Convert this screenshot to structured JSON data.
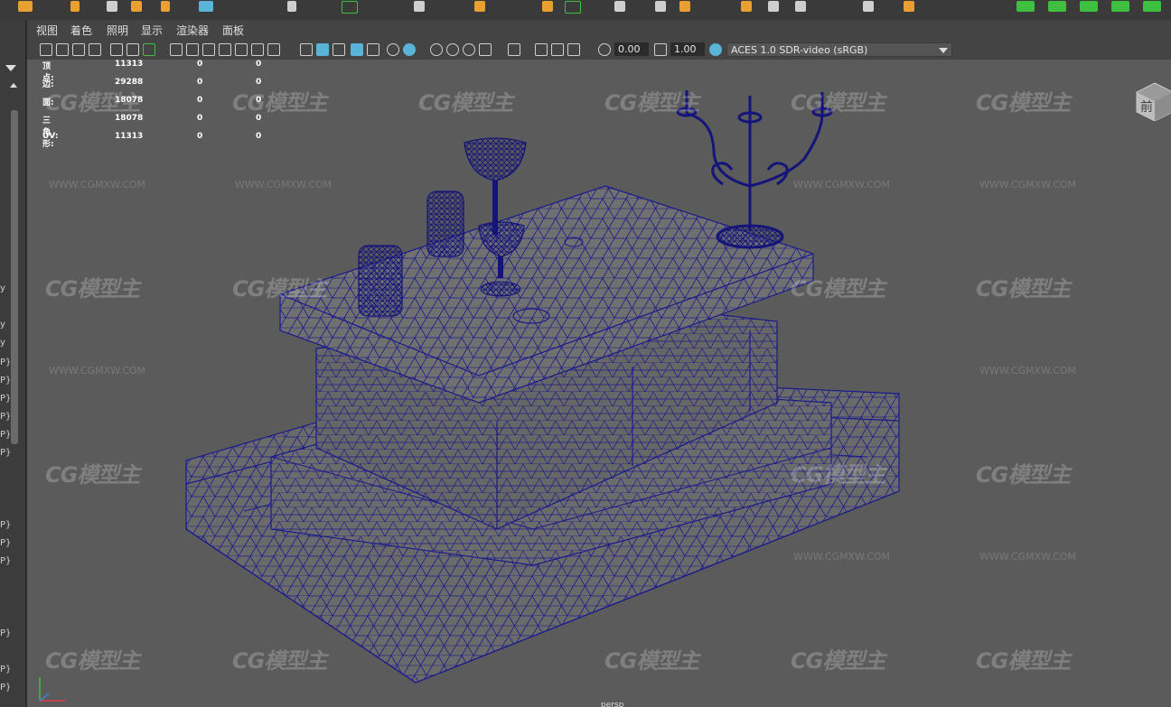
{
  "menu": [
    "视图",
    "着色",
    "照明",
    "显示",
    "渲染器",
    "面板"
  ],
  "toolbar": {
    "exposure_value": "0.00",
    "gamma_value": "1.00",
    "colorspace": "ACES 1.0 SDR-video (sRGB)"
  },
  "hud": [
    {
      "label": "顶点:",
      "v1": "11313",
      "v2": "0",
      "v3": "0"
    },
    {
      "label": "边:",
      "v1": "29288",
      "v2": "0",
      "v3": "0"
    },
    {
      "label": "面:",
      "v1": "18078",
      "v2": "0",
      "v3": "0"
    },
    {
      "label": "三角形:",
      "v1": "18078",
      "v2": "0",
      "v3": "0"
    },
    {
      "label": "UV:",
      "v1": "11313",
      "v2": "0",
      "v3": "0"
    }
  ],
  "viewcube_label": "前",
  "camera_label": "persp",
  "watermark": {
    "logo": "CG模型主",
    "url": "WWW.CGMXW.COM"
  },
  "left_panel": {
    "y": "y",
    "p": "P}"
  },
  "colors": {
    "wire": "#1a1a8c",
    "viewport_bg": "#5b5b5b",
    "accent_orange": "#e8a030",
    "accent_green": "#3fbf3f"
  },
  "icons": [
    "camera-icon",
    "grid-icon",
    "wireframe-icon",
    "shaded-icon",
    "light-icon",
    "isolate-icon",
    "colorspace-icon"
  ]
}
